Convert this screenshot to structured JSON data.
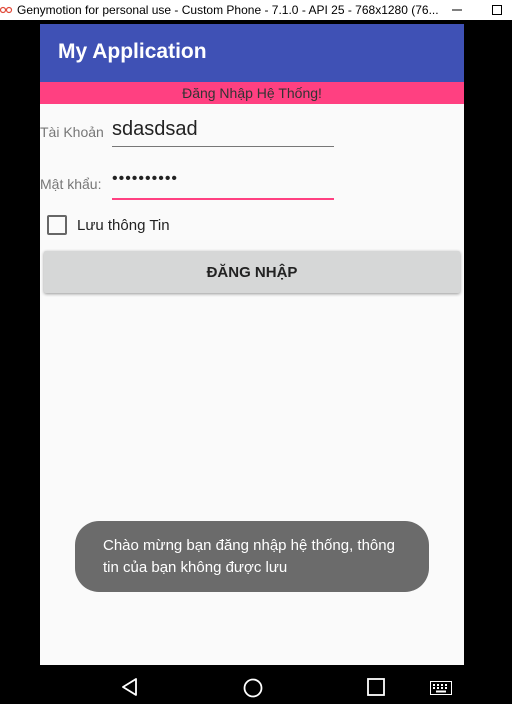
{
  "window": {
    "title": "Genymotion for personal use - Custom Phone - 7.1.0 - API 25 - 768x1280 (76..."
  },
  "app": {
    "title": "My Application",
    "banner": "Đăng Nhập Hệ Thống!",
    "username_label": "Tài Khoản",
    "username_value": "sdasdsad",
    "password_label": "Mật khẩu:",
    "password_value": "••••••••••",
    "remember_label": "Lưu thông Tin",
    "login_button": "ĐĂNG NHẬP",
    "toast": "Chào mừng bạn đăng nhập hệ thống, thông tin của bạn không được lưu"
  },
  "colors": {
    "appbar": "#3f51b5",
    "accent": "#ff4081",
    "toast": "#6b6b6b"
  },
  "icons": [
    "genymotion-icon",
    "minimize-icon",
    "maximize-icon",
    "back-icon",
    "home-icon",
    "recent-apps-icon",
    "keyboard-icon"
  ]
}
